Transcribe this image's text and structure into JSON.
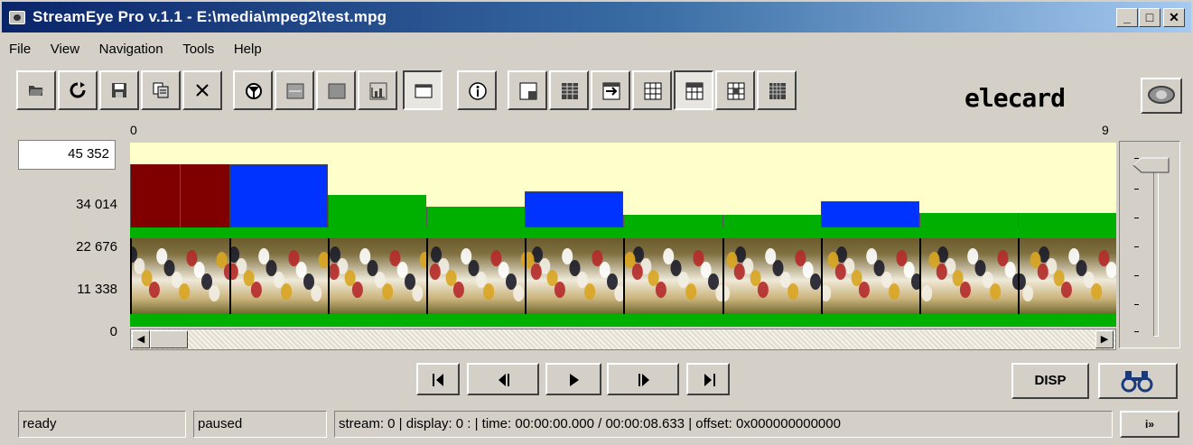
{
  "window": {
    "title": "StreamEye Pro v.1.1 - E:\\media\\mpeg2\\test.mpg",
    "minimize_label": "_",
    "maximize_label": "□",
    "close_label": "✕"
  },
  "menu": [
    "File",
    "View",
    "Navigation",
    "Tools",
    "Help"
  ],
  "toolbar": {
    "icons": [
      "open-folder-icon",
      "reload-icon",
      "save-icon",
      "copy-icon",
      "close-x-icon",
      "filter-icon",
      "panel-icon",
      "square-icon",
      "bitrate-chart-icon",
      "frame-icon",
      "info-icon",
      "layout-1-icon",
      "grid-1-icon",
      "grid-2-icon",
      "grid-3-icon",
      "grid-4-icon",
      "grid-5-icon",
      "grid-6-icon"
    ],
    "pressed": "frame-icon",
    "logo_text": "elecard"
  },
  "graph": {
    "start_index": "0",
    "end_index": "9",
    "y_max_value": "45 352",
    "y_labels": [
      "34 014",
      "22 676",
      "11 338",
      "0"
    ],
    "frames": [
      {
        "type": "I",
        "size_fraction": 0.74,
        "color": "#800000"
      },
      {
        "type": "I",
        "size_fraction": 0.74,
        "color": "#800000"
      },
      {
        "type": "P",
        "size_fraction": 0.74,
        "color": "#0033ff"
      },
      {
        "type": "B",
        "size_fraction": 0.38,
        "color": "#00b000"
      },
      {
        "type": "B",
        "size_fraction": 0.24,
        "color": "#00b000"
      },
      {
        "type": "P",
        "size_fraction": 0.43,
        "color": "#0033ff"
      },
      {
        "type": "B",
        "size_fraction": 0.15,
        "color": "#00b000"
      },
      {
        "type": "B",
        "size_fraction": 0.15,
        "color": "#00b000"
      },
      {
        "type": "P",
        "size_fraction": 0.31,
        "color": "#0033ff"
      },
      {
        "type": "B",
        "size_fraction": 0.17,
        "color": "#00b000"
      },
      {
        "type": "B",
        "size_fraction": 0.17,
        "color": "#00b000"
      }
    ]
  },
  "navigation": {
    "buttons": [
      "first-frame-icon",
      "previous-frame-icon",
      "play-icon",
      "next-frame-icon",
      "last-frame-icon"
    ],
    "disp_label": "DISP"
  },
  "status": {
    "state": "ready",
    "playback": "paused",
    "info": "stream: 0 | display: 0 : | time: 00:00:00.000 / 00:00:08.633 | offset: 0x000000000000",
    "button_label": "i»"
  }
}
